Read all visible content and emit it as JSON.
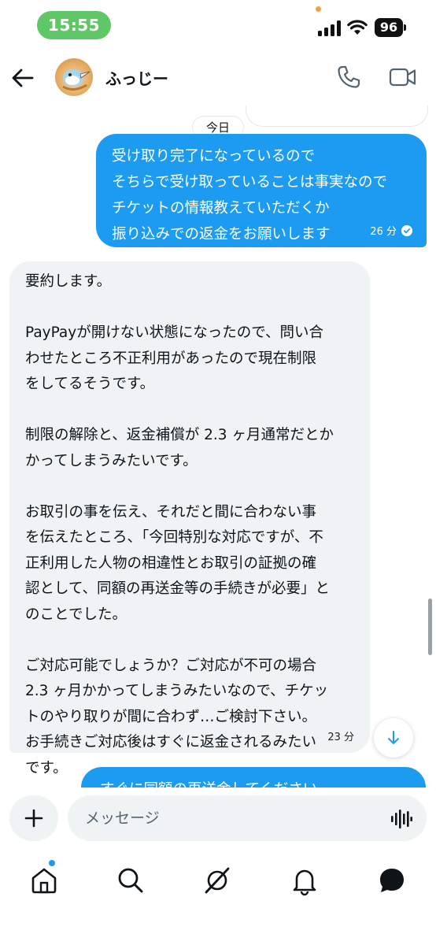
{
  "status_bar": {
    "time": "15:55",
    "battery": "96"
  },
  "header": {
    "contact_name": "ふっじー"
  },
  "chat": {
    "date_label": "今日",
    "messages": [
      {
        "direction": "outgoing",
        "text": "受け取り完了になっているので\nそちらで受け取っていることは事実なので\nチケットの情報教えていただくか\n振り込みでの返金をお願いします",
        "time": "26 分"
      },
      {
        "direction": "incoming",
        "text": "要約します。\n\nPayPayが開けない状態になったので、問い合\nわせたところ不正利用があったので現在制限\nをしてるそうです。\n\n制限の解除と、返金補償が 2.3 ヶ月通常だとか\nかってしまうみたいです。\n\nお取引の事を伝え、それだと間に合わない事\nを伝えたところ、「今回特別な対応ですが、不\n正利用した人物の相違性とお取引の証拠の確\n認として、同額の再送金等の手続きが必要」と\nのことでした。\n\nご対応可能でしょうか？ご対応が不可の場合\n2.3 ヶ月かかってしまうみたいなので、チケッ\nトのやり取りが間に合わず…ご検討下さい。\nお手続きご対応後はすぐに返金されるみたい\nです。",
        "time": "23 分"
      },
      {
        "direction": "outgoing",
        "text": "すぐに同額の再送金してください"
      }
    ]
  },
  "composer": {
    "placeholder": "メッセージ"
  },
  "colors": {
    "accent": "#1d9bf0",
    "incoming_bubble": "#eff3f4",
    "time_pill": "#5fc766"
  },
  "icons": {
    "status": [
      "signal-icon",
      "wifi-icon"
    ],
    "header": [
      "back-arrow-icon",
      "phone-icon",
      "video-icon"
    ],
    "composer": [
      "plus-icon",
      "voice-icon"
    ],
    "bottom_nav": [
      "home-icon",
      "search-icon",
      "grok-icon",
      "notifications-icon",
      "messages-icon"
    ]
  }
}
